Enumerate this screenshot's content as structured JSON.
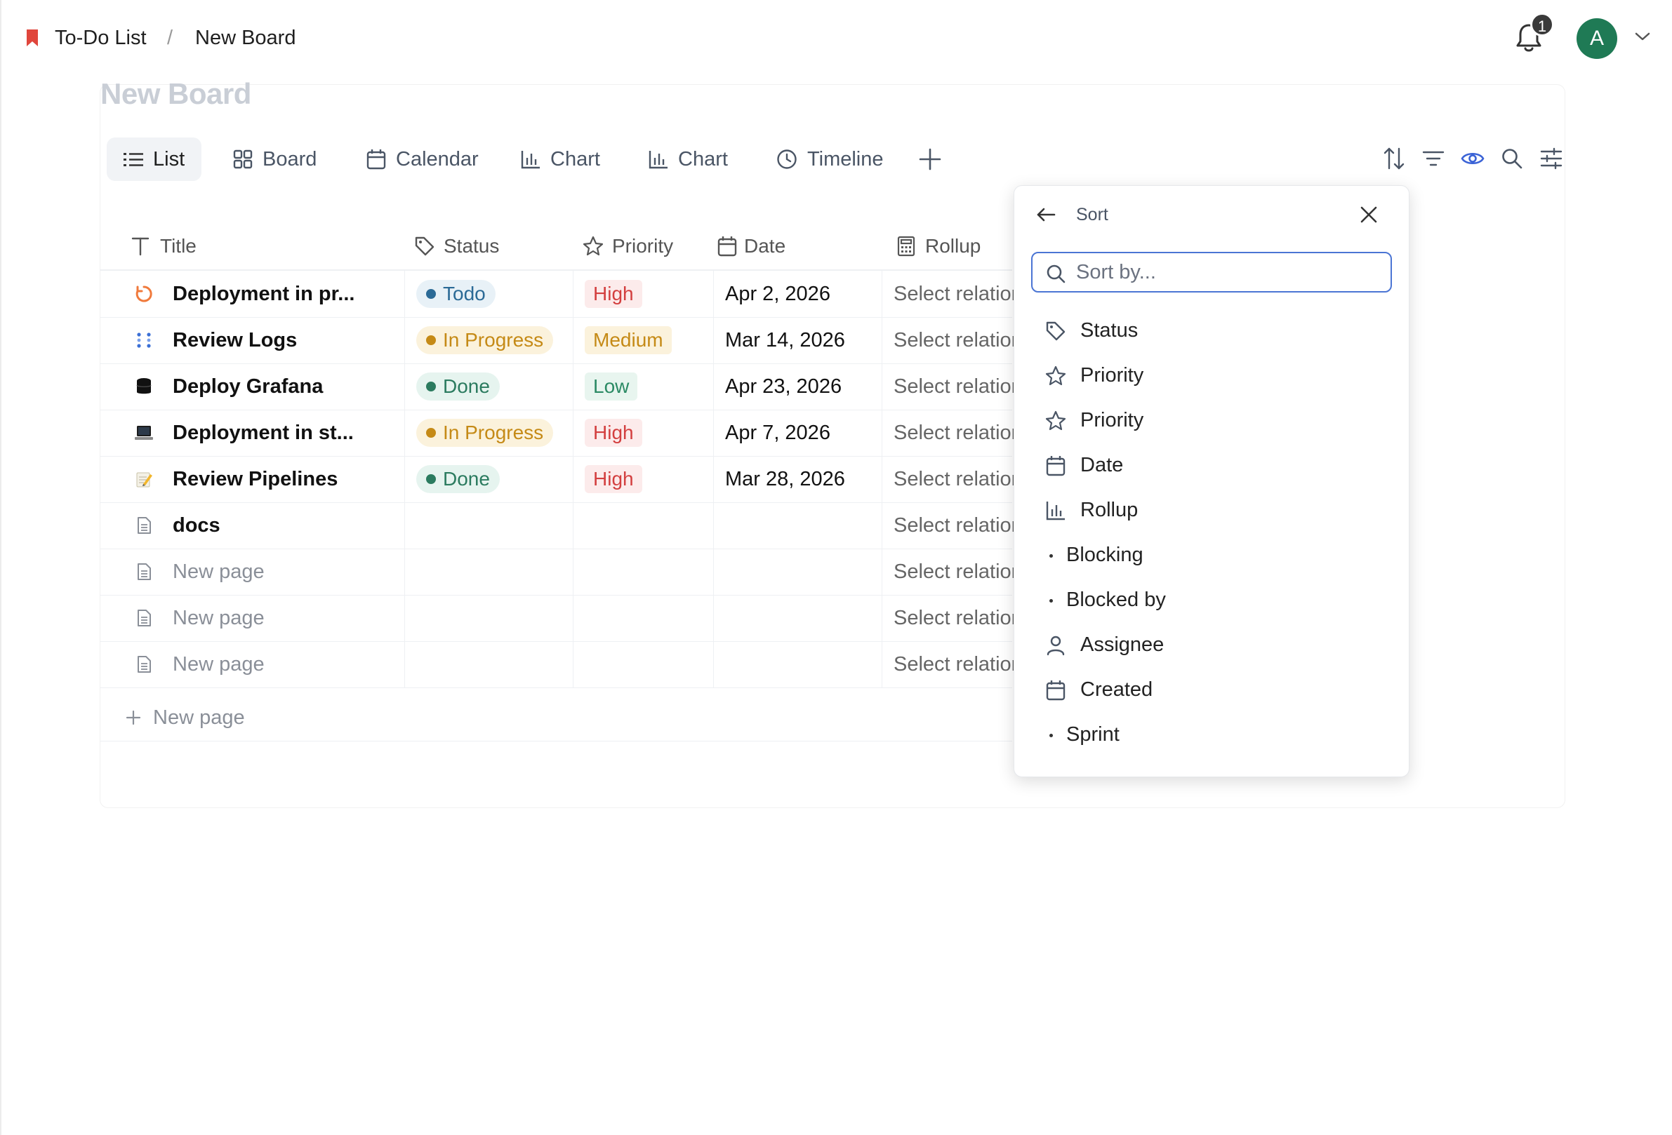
{
  "breadcrumb": {
    "workspace": "To-Do List",
    "separator": "/",
    "page": "New Board"
  },
  "notifications": {
    "count": "1"
  },
  "user": {
    "initial": "A"
  },
  "board": {
    "title": "New Board"
  },
  "views": [
    {
      "label": "List",
      "icon": "list-icon",
      "active": true
    },
    {
      "label": "Board",
      "icon": "grid-icon"
    },
    {
      "label": "Calendar",
      "icon": "calendar-icon"
    },
    {
      "label": "Chart",
      "icon": "bar-chart-icon"
    },
    {
      "label": "Chart",
      "icon": "bar-chart-icon"
    },
    {
      "label": "Timeline",
      "icon": "clock-icon"
    }
  ],
  "columns": {
    "title": "Title",
    "status": "Status",
    "priority": "Priority",
    "date": "Date",
    "rollup": "Rollup"
  },
  "rows": [
    {
      "title": "Deployment in pr...",
      "icon": "loading-icon",
      "status": "Todo",
      "priority": "High",
      "date": "Apr 2, 2026",
      "rollup": "Select relation"
    },
    {
      "title": "Review Logs",
      "icon": "dots-icon",
      "status": "In Progress",
      "priority": "Medium",
      "date": "Mar 14, 2026",
      "rollup": "Select relation"
    },
    {
      "title": "Deploy Grafana",
      "icon": "database-icon",
      "status": "Done",
      "priority": "Low",
      "date": "Apr 23, 2026",
      "rollup": "Select relation"
    },
    {
      "title": "Deployment in st...",
      "icon": "laptop-icon",
      "status": "In Progress",
      "priority": "High",
      "date": "Apr 7, 2026",
      "rollup": "Select relation"
    },
    {
      "title": "Review Pipelines",
      "icon": "memo-icon",
      "status": "Done",
      "priority": "High",
      "date": "Mar 28, 2026",
      "rollup": "Select relation"
    },
    {
      "title": "docs",
      "icon": "page-icon",
      "status": "",
      "priority": "",
      "date": "",
      "rollup": "Select relation"
    },
    {
      "title": "New page",
      "icon": "page-icon",
      "status": "",
      "priority": "",
      "date": "",
      "rollup": "Select relation"
    },
    {
      "title": "New page",
      "icon": "page-icon",
      "status": "",
      "priority": "",
      "date": "",
      "rollup": "Select relation"
    },
    {
      "title": "New page",
      "icon": "page-icon",
      "status": "",
      "priority": "",
      "date": "",
      "rollup": "Select relation"
    }
  ],
  "new_page_label": "New page",
  "sort_panel": {
    "title": "Sort",
    "search_placeholder": "Sort by...",
    "options": [
      {
        "label": "Status",
        "icon": "tag-icon"
      },
      {
        "label": "Priority",
        "icon": "star-icon"
      },
      {
        "label": "Priority",
        "icon": "star-icon"
      },
      {
        "label": "Date",
        "icon": "calendar-icon"
      },
      {
        "label": "Rollup",
        "icon": "bar-chart-icon"
      },
      {
        "label": "Blocking",
        "icon": "bullet-icon"
      },
      {
        "label": "Blocked by",
        "icon": "bullet-icon"
      },
      {
        "label": "Assignee",
        "icon": "person-icon"
      },
      {
        "label": "Created",
        "icon": "calendar-icon"
      },
      {
        "label": "Sprint",
        "icon": "bullet-icon"
      }
    ]
  },
  "colors": {
    "accent": "#4b75d4",
    "avatar": "#1f7a55",
    "todo": "#2b6a96",
    "in_progress": "#c58a16",
    "done": "#2b7b5f",
    "high": "#d33f3f",
    "low": "#2b8a64",
    "bookmark": "#e0463c"
  }
}
